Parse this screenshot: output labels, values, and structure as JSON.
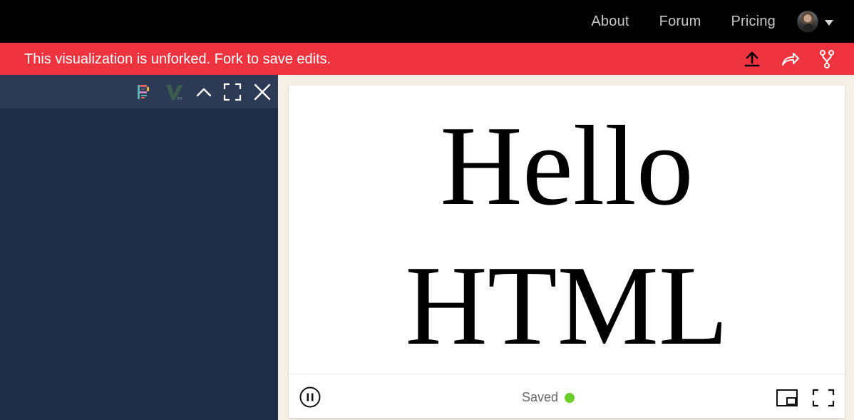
{
  "nav": {
    "links": [
      "About",
      "Forum",
      "Pricing"
    ],
    "avatar_icon": "user-avatar",
    "menu_icon": "caret-down-icon"
  },
  "banner": {
    "message": "This visualization is unforked. Fork to save edits.",
    "color": "#ef343f",
    "icons": [
      "upload-icon",
      "share-icon",
      "fork-icon"
    ]
  },
  "editor_toolbar": {
    "icons": [
      "prettier-icon",
      "vim-icon",
      "chevron-up-icon",
      "expand-icon",
      "close-icon"
    ]
  },
  "preview": {
    "line1": "Hello",
    "line2": "HTML",
    "status": "Saved",
    "status_color": "#6bcf2a",
    "icons": [
      "pause-icon",
      "picture-in-picture-icon",
      "fullscreen-icon"
    ]
  }
}
